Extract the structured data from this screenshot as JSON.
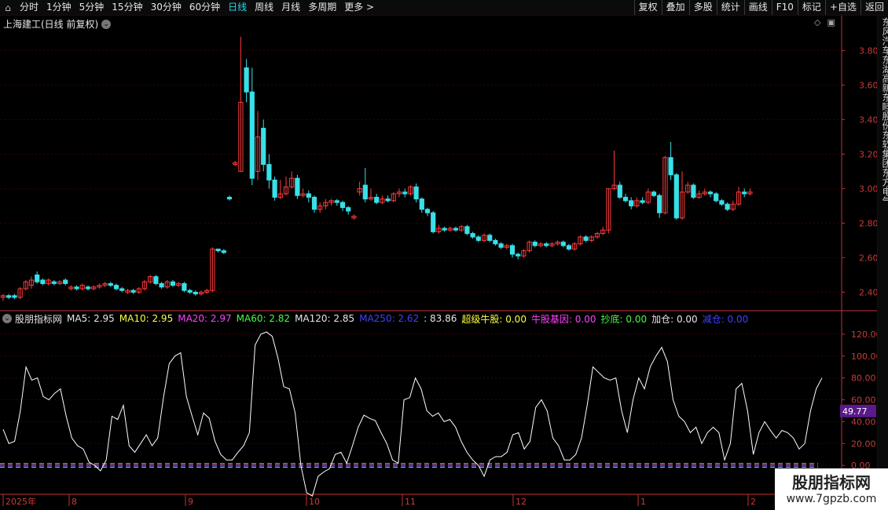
{
  "toolbar": {
    "left": [
      {
        "label": "分时",
        "active": false
      },
      {
        "label": "1分钟",
        "active": false
      },
      {
        "label": "5分钟",
        "active": false
      },
      {
        "label": "15分钟",
        "active": false
      },
      {
        "label": "30分钟",
        "active": false
      },
      {
        "label": "60分钟",
        "active": false
      },
      {
        "label": "日线",
        "active": true
      },
      {
        "label": "周线",
        "active": false
      },
      {
        "label": "月线",
        "active": false
      },
      {
        "label": "多周期",
        "active": false
      },
      {
        "label": "更多 >",
        "active": false
      }
    ],
    "right": [
      "复权",
      "叠加",
      "多股",
      "统计",
      "画线",
      "F10",
      "标记",
      "+自选",
      "返回"
    ]
  },
  "title": "上海建工(日线 前复权)",
  "price_axis": {
    "ticks": [
      "3.80",
      "3.60",
      "3.40",
      "3.20",
      "3.00",
      "2.80",
      "2.60",
      "2.40"
    ]
  },
  "indicator_axis": {
    "ticks": [
      "120.00",
      "100.00",
      "80.00",
      "60.00",
      "40.00",
      "20.00",
      "0.00"
    ],
    "current_value": "49.77"
  },
  "indicator_header": [
    {
      "text": "股朋指标网",
      "color": "#e6e6e6"
    },
    {
      "text": "MA5: 2.95",
      "color": "#e6e6e6"
    },
    {
      "text": "MA10: 2.95",
      "color": "#ffff40"
    },
    {
      "text": "MA20: 2.97",
      "color": "#ff40ff"
    },
    {
      "text": "MA60: 2.82",
      "color": "#40ff40"
    },
    {
      "text": "MA120: 2.85",
      "color": "#e6e6e6"
    },
    {
      "text": "MA250: 2.62",
      "color": "#4040ff"
    },
    {
      "text": ": 83.86",
      "color": "#e6e6e6"
    },
    {
      "text": "超级牛股: 0.00",
      "color": "#ffff40"
    },
    {
      "text": "牛股基因: 0.00",
      "color": "#ff40ff"
    },
    {
      "text": "抄底: 0.00",
      "color": "#40ff40"
    },
    {
      "text": "加仓: 0.00",
      "color": "#e6e6e6"
    },
    {
      "text": "减仓: 0.00",
      "color": "#4040ff"
    }
  ],
  "date_axis": {
    "labels": [
      "2025年",
      "8",
      "9",
      "10",
      "11",
      "12",
      "1",
      "2"
    ]
  },
  "right_panel_text": "东风汽车东湖高新东睦股份东软集团东方电气",
  "logo": {
    "line1": "股朋指标网",
    "line2": "www.7gpzb.com"
  },
  "colors": {
    "up": "#ff3b3b",
    "down": "#38e0e8",
    "grid": "#3a0000",
    "axis": "#c83232",
    "indicator_line": "#ffffff",
    "value_box": "#5a1a8a"
  },
  "chart_data": {
    "type": "candlestick",
    "price_ylim": [
      2.32,
      3.92
    ],
    "candles": [
      [
        2.37,
        2.38,
        2.39,
        2.35
      ],
      [
        2.38,
        2.37,
        2.39,
        2.36
      ],
      [
        2.38,
        2.37,
        2.39,
        2.36
      ],
      [
        2.37,
        2.42,
        2.43,
        2.36
      ],
      [
        2.42,
        2.46,
        2.47,
        2.41
      ],
      [
        2.44,
        2.47,
        2.49,
        2.42
      ],
      [
        2.5,
        2.46,
        2.52,
        2.45
      ],
      [
        2.47,
        2.45,
        2.48,
        2.44
      ],
      [
        2.45,
        2.47,
        2.48,
        2.44
      ],
      [
        2.46,
        2.45,
        2.47,
        2.44
      ],
      [
        2.45,
        2.46,
        2.47,
        2.44
      ],
      [
        2.47,
        2.45,
        2.48,
        2.44
      ],
      [
        2.42,
        2.43,
        2.44,
        2.41
      ],
      [
        2.43,
        2.42,
        2.44,
        2.41
      ],
      [
        2.42,
        2.44,
        2.45,
        2.41
      ],
      [
        2.43,
        2.42,
        2.44,
        2.41
      ],
      [
        2.42,
        2.43,
        2.44,
        2.41
      ],
      [
        2.43,
        2.44,
        2.45,
        2.42
      ],
      [
        2.44,
        2.45,
        2.46,
        2.43
      ],
      [
        2.45,
        2.44,
        2.46,
        2.43
      ],
      [
        2.44,
        2.42,
        2.45,
        2.41
      ],
      [
        2.42,
        2.41,
        2.43,
        2.4
      ],
      [
        2.4,
        2.41,
        2.42,
        2.39
      ],
      [
        2.41,
        2.4,
        2.42,
        2.39
      ],
      [
        2.4,
        2.42,
        2.43,
        2.39
      ],
      [
        2.42,
        2.46,
        2.47,
        2.41
      ],
      [
        2.46,
        2.49,
        2.5,
        2.45
      ],
      [
        2.49,
        2.45,
        2.5,
        2.44
      ],
      [
        2.45,
        2.43,
        2.46,
        2.42
      ],
      [
        2.43,
        2.46,
        2.47,
        2.42
      ],
      [
        2.46,
        2.44,
        2.47,
        2.43
      ],
      [
        2.44,
        2.45,
        2.46,
        2.43
      ],
      [
        2.45,
        2.41,
        2.46,
        2.4
      ],
      [
        2.41,
        2.4,
        2.42,
        2.39
      ],
      [
        2.4,
        2.39,
        2.41,
        2.38
      ],
      [
        2.39,
        2.4,
        2.41,
        2.38
      ],
      [
        2.4,
        2.41,
        2.42,
        2.39
      ],
      [
        2.41,
        2.65,
        2.66,
        2.4
      ],
      [
        2.65,
        2.64,
        2.65,
        2.63
      ],
      [
        2.64,
        2.63,
        2.65,
        2.62
      ],
      [
        2.95,
        2.94,
        2.96,
        2.93
      ],
      [
        3.14,
        3.15,
        3.16,
        3.13
      ],
      [
        3.1,
        3.5,
        3.88,
        3.1
      ],
      [
        3.7,
        3.56,
        3.75,
        3.5
      ],
      [
        3.56,
        3.06,
        3.7,
        3.02
      ],
      [
        3.1,
        3.3,
        3.45,
        3.05
      ],
      [
        3.35,
        3.14,
        3.4,
        3.1
      ],
      [
        3.14,
        3.05,
        3.2,
        3.0
      ],
      [
        3.05,
        2.95,
        3.07,
        2.93
      ],
      [
        2.95,
        2.97,
        3.05,
        2.94
      ],
      [
        2.97,
        3.01,
        3.07,
        2.96
      ],
      [
        3.01,
        3.06,
        3.1,
        3.0
      ],
      [
        3.06,
        2.96,
        3.08,
        2.94
      ],
      [
        2.96,
        2.97,
        3.0,
        2.95
      ],
      [
        2.97,
        2.95,
        2.99,
        2.92
      ],
      [
        2.95,
        2.88,
        2.96,
        2.86
      ],
      [
        2.88,
        2.9,
        2.92,
        2.86
      ],
      [
        2.9,
        2.92,
        2.94,
        2.88
      ],
      [
        2.92,
        2.93,
        2.94,
        2.9
      ],
      [
        2.93,
        2.92,
        2.94,
        2.9
      ],
      [
        2.92,
        2.89,
        2.93,
        2.87
      ],
      [
        2.89,
        2.87,
        2.9,
        2.85
      ],
      [
        2.83,
        2.84,
        2.85,
        2.82
      ],
      [
        2.98,
        3.0,
        3.04,
        2.96
      ],
      [
        3.02,
        2.94,
        3.12,
        2.92
      ],
      [
        2.94,
        2.95,
        3.0,
        2.93
      ],
      [
        2.95,
        2.92,
        2.97,
        2.91
      ],
      [
        2.92,
        2.94,
        2.96,
        2.91
      ],
      [
        2.94,
        2.93,
        2.96,
        2.92
      ],
      [
        2.93,
        2.97,
        2.98,
        2.92
      ],
      [
        2.97,
        2.98,
        3.0,
        2.95
      ],
      [
        2.98,
        2.97,
        3.0,
        2.95
      ],
      [
        2.97,
        3.01,
        3.02,
        2.96
      ],
      [
        3.01,
        2.94,
        3.03,
        2.92
      ],
      [
        2.94,
        2.88,
        2.95,
        2.86
      ],
      [
        2.88,
        2.86,
        2.89,
        2.84
      ],
      [
        2.86,
        2.75,
        2.87,
        2.74
      ],
      [
        2.75,
        2.77,
        2.79,
        2.74
      ],
      [
        2.77,
        2.76,
        2.78,
        2.75
      ],
      [
        2.76,
        2.77,
        2.78,
        2.75
      ],
      [
        2.77,
        2.76,
        2.78,
        2.75
      ],
      [
        2.76,
        2.78,
        2.79,
        2.75
      ],
      [
        2.78,
        2.74,
        2.79,
        2.73
      ],
      [
        2.74,
        2.72,
        2.75,
        2.71
      ],
      [
        2.72,
        2.7,
        2.73,
        2.69
      ],
      [
        2.7,
        2.73,
        2.74,
        2.69
      ],
      [
        2.73,
        2.7,
        2.74,
        2.69
      ],
      [
        2.7,
        2.68,
        2.71,
        2.67
      ],
      [
        2.68,
        2.66,
        2.69,
        2.65
      ],
      [
        2.66,
        2.67,
        2.68,
        2.65
      ],
      [
        2.67,
        2.62,
        2.68,
        2.6
      ],
      [
        2.62,
        2.61,
        2.63,
        2.59
      ],
      [
        2.61,
        2.64,
        2.65,
        2.6
      ],
      [
        2.64,
        2.69,
        2.7,
        2.63
      ],
      [
        2.69,
        2.67,
        2.7,
        2.66
      ],
      [
        2.67,
        2.68,
        2.69,
        2.66
      ],
      [
        2.68,
        2.67,
        2.69,
        2.66
      ],
      [
        2.67,
        2.68,
        2.69,
        2.66
      ],
      [
        2.68,
        2.69,
        2.7,
        2.67
      ],
      [
        2.69,
        2.67,
        2.7,
        2.66
      ],
      [
        2.67,
        2.65,
        2.68,
        2.64
      ],
      [
        2.65,
        2.68,
        2.69,
        2.64
      ],
      [
        2.68,
        2.72,
        2.73,
        2.67
      ],
      [
        2.72,
        2.7,
        2.73,
        2.69
      ],
      [
        2.7,
        2.72,
        2.73,
        2.69
      ],
      [
        2.72,
        2.74,
        2.75,
        2.71
      ],
      [
        2.74,
        2.76,
        2.78,
        2.73
      ],
      [
        2.76,
        3.0,
        3.0,
        2.74
      ],
      [
        3.0,
        3.02,
        3.22,
        2.99
      ],
      [
        3.02,
        2.95,
        3.04,
        2.94
      ],
      [
        2.95,
        2.93,
        2.97,
        2.92
      ],
      [
        2.93,
        2.9,
        2.95,
        2.88
      ],
      [
        2.9,
        2.93,
        2.95,
        2.89
      ],
      [
        2.93,
        2.92,
        2.95,
        2.91
      ],
      [
        2.92,
        2.98,
        3.0,
        2.91
      ],
      [
        2.98,
        2.96,
        2.99,
        2.95
      ],
      [
        2.96,
        2.86,
        2.97,
        2.83
      ],
      [
        2.86,
        3.18,
        3.19,
        2.85
      ],
      [
        3.18,
        3.08,
        3.27,
        3.05
      ],
      [
        3.08,
        2.83,
        3.09,
        2.82
      ],
      [
        2.83,
        2.98,
        3.1,
        2.82
      ],
      [
        2.98,
        3.02,
        3.04,
        2.97
      ],
      [
        3.02,
        2.95,
        3.03,
        2.94
      ],
      [
        2.95,
        2.97,
        2.99,
        2.94
      ],
      [
        2.97,
        2.98,
        3.0,
        2.96
      ],
      [
        2.98,
        2.97,
        2.99,
        2.95
      ],
      [
        2.97,
        2.93,
        2.98,
        2.92
      ],
      [
        2.93,
        2.91,
        2.94,
        2.9
      ],
      [
        2.91,
        2.88,
        2.92,
        2.87
      ],
      [
        2.88,
        2.91,
        2.93,
        2.87
      ],
      [
        2.91,
        2.98,
        3.01,
        2.9
      ],
      [
        2.98,
        2.97,
        3.0,
        2.95
      ],
      [
        2.97,
        2.98,
        3.0,
        2.96
      ]
    ],
    "indicator_ylim": [
      -25,
      130
    ],
    "indicator": [
      33,
      20,
      22,
      50,
      90,
      78,
      80,
      63,
      60,
      66,
      70,
      45,
      25,
      18,
      15,
      3,
      0,
      -5,
      5,
      45,
      42,
      55,
      18,
      12,
      20,
      28,
      18,
      25,
      62,
      93,
      100,
      103,
      63,
      45,
      28,
      48,
      43,
      22,
      10,
      5,
      5,
      12,
      18,
      30,
      110,
      120,
      122,
      118,
      98,
      72,
      70,
      48,
      0,
      -25,
      -28,
      -10,
      -6,
      -3,
      10,
      12,
      2,
      18,
      35,
      46,
      43,
      41,
      30,
      20,
      5,
      2,
      60,
      62,
      80,
      70,
      50,
      45,
      48,
      40,
      42,
      35,
      22,
      12,
      5,
      0,
      -10,
      5,
      8,
      8,
      12,
      28,
      30,
      15,
      22,
      53,
      60,
      50,
      25,
      18,
      5,
      5,
      10,
      25,
      55,
      90,
      85,
      80,
      78,
      80,
      50,
      30,
      60,
      80,
      70,
      90,
      100,
      108,
      95,
      60,
      45,
      40,
      30,
      35,
      20,
      30,
      35,
      30,
      5,
      20,
      70,
      75,
      50,
      10,
      30,
      40,
      32,
      25,
      32,
      30,
      25,
      15,
      20,
      50,
      70,
      80
    ],
    "indicator_current": 49.77
  }
}
